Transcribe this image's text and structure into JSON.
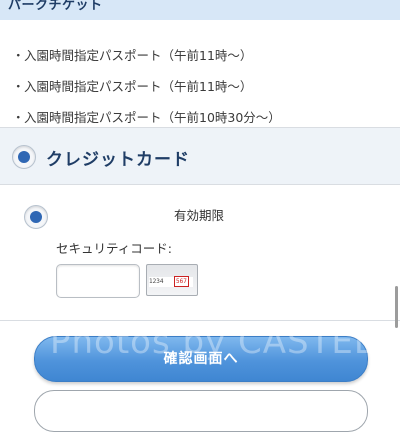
{
  "header": {
    "title": "パークチケット"
  },
  "tickets": [
    "入園時間指定パスポート（午前11時〜）",
    "入園時間指定パスポート（午前11時〜）",
    "入園時間指定パスポート（午前10時30分〜）"
  ],
  "payment": {
    "title": "クレジットカード",
    "expiry_label": "有効期限",
    "security_label": "セキュリティコード:",
    "sample_number": "1234",
    "sample_code": "567"
  },
  "actions": {
    "confirm_label": "確認画面へ"
  },
  "watermark": "Photos by CASTEL",
  "colors": {
    "accent": "#2f67b4",
    "button": "#4f93db",
    "header_band": "#d7e7f7"
  }
}
